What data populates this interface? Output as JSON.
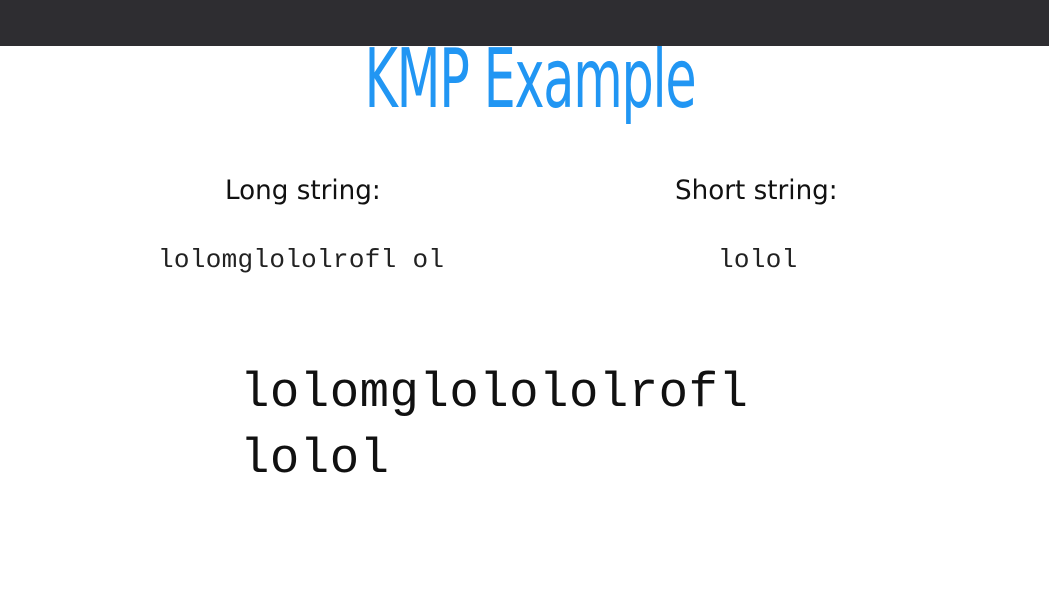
{
  "page": {
    "title": "KMP Example",
    "title_color": "#2196f3",
    "top_bar_color": "#2e2d31"
  },
  "inputs": {
    "long_label": "Long string:",
    "long_value": "lolomglololrofl ol",
    "short_label": "Short string:",
    "short_value": "lolol"
  },
  "result": {
    "long_line": "lolomglolololrofl",
    "short_line": "lolol"
  }
}
